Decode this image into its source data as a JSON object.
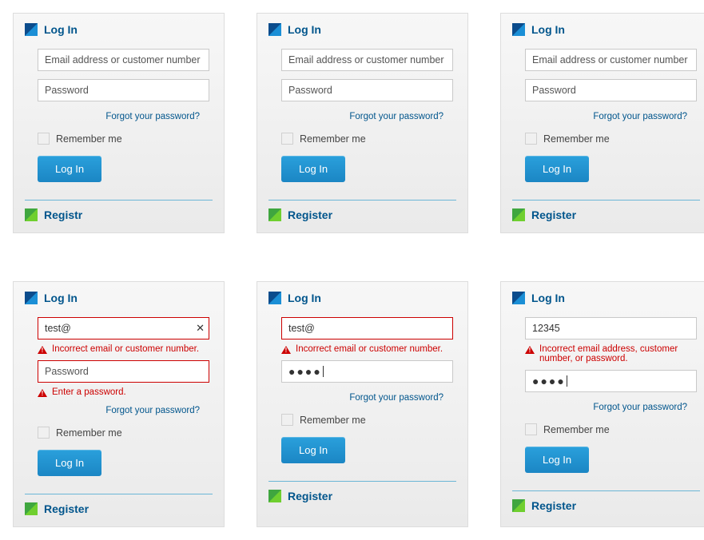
{
  "common": {
    "login_title": "Log In",
    "email_placeholder": "Email address or customer number",
    "password_placeholder": "Password",
    "forgot": "Forgot your password?",
    "remember": "Remember me",
    "login_btn": "Log In",
    "dots": "●●●●"
  },
  "cards": {
    "c1": {
      "register": "Registr"
    },
    "c2": {
      "register": "Register"
    },
    "c3": {
      "register": "Register"
    },
    "c4": {
      "register": "Register",
      "email_value": "test@",
      "err_email": "Incorrect email or customer number.",
      "err_pass": "Enter a password."
    },
    "c5": {
      "register": "Register",
      "email_value": "test@",
      "err_email": "Incorrect email or customer number."
    },
    "c6": {
      "register": "Register",
      "email_value": "12345",
      "err_combo": "Incorrect email address, customer number, or password."
    }
  }
}
